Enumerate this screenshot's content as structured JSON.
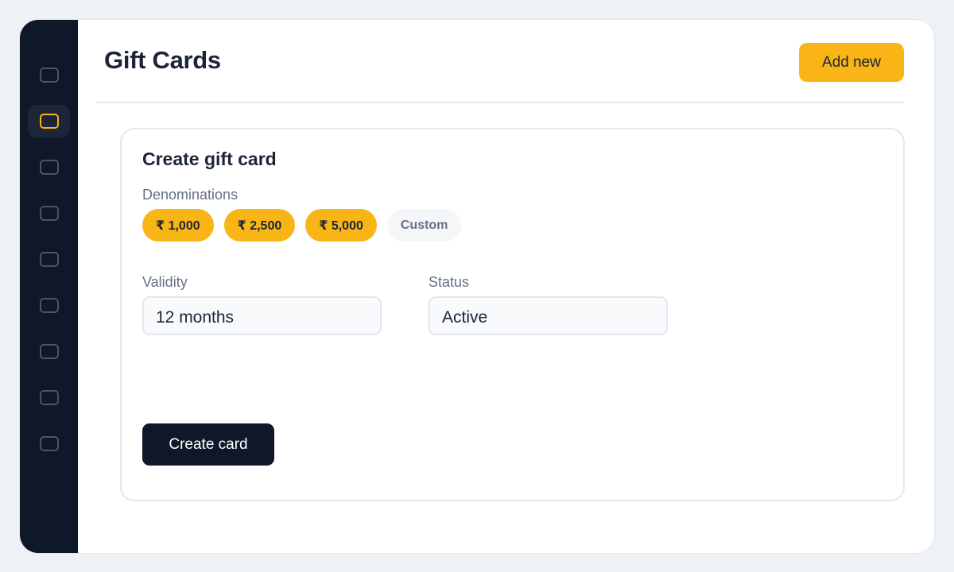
{
  "sidebar": {
    "items": [
      {
        "icon": "nav-icon-1",
        "active": false
      },
      {
        "icon": "nav-icon-2",
        "active": true
      },
      {
        "icon": "nav-icon-3",
        "active": false
      },
      {
        "icon": "nav-icon-4",
        "active": false
      },
      {
        "icon": "nav-icon-5",
        "active": false
      },
      {
        "icon": "nav-icon-6",
        "active": false
      },
      {
        "icon": "nav-icon-7",
        "active": false
      },
      {
        "icon": "nav-icon-8",
        "active": false
      },
      {
        "icon": "nav-icon-9",
        "active": false
      }
    ]
  },
  "header": {
    "title": "Gift Cards",
    "add_label": "Add new"
  },
  "form": {
    "title": "Create gift card",
    "denominations_label": "Denominations",
    "denominations": [
      {
        "label": "₹ 1,000",
        "selected": true
      },
      {
        "label": "₹ 2,500",
        "selected": true
      },
      {
        "label": "₹ 5,000",
        "selected": true
      },
      {
        "label": "Custom",
        "selected": false
      }
    ],
    "validity_label": "Validity",
    "validity_value": "12 months",
    "status_label": "Status",
    "status_value": "Active",
    "submit_label": "Create card"
  },
  "colors": {
    "accent": "#f9b416",
    "sidebar_bg": "#0f1829",
    "text_primary": "#1c2536",
    "text_muted": "#667085"
  }
}
